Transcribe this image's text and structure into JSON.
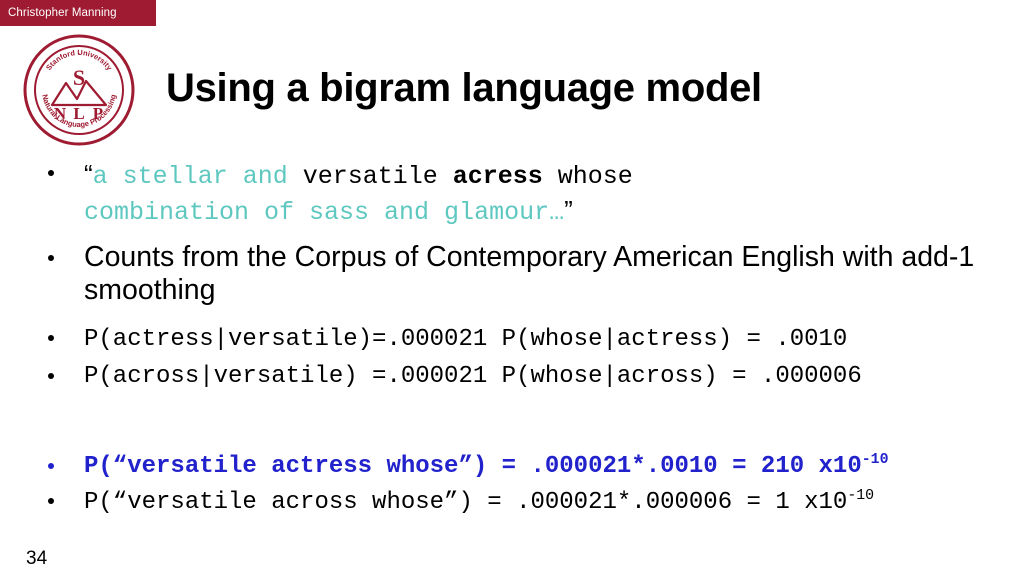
{
  "header": {
    "author_name": "Christopher Manning",
    "bar_color": "#9e1b32"
  },
  "logo": {
    "alt": "stanford-nlp-logo",
    "top_text": "Stanford University",
    "bottom_text": "Natural Language Processing",
    "letters": [
      "S",
      "N",
      "L",
      "P"
    ],
    "color": "#9e1b32"
  },
  "title": "Using a bigram language model",
  "slide_number": "34",
  "colors": {
    "teal": "#5ec8c0",
    "blue": "#2222cc",
    "black": "#000000"
  },
  "bullets": {
    "quote": {
      "open_quote": "“",
      "teal_part_1": "a stellar and ",
      "plain_part_1": "versatile ",
      "bold_part": "acress",
      "plain_part_2": " whose",
      "teal_part_2": "combination of sass and glamour…",
      "close_quote": "”"
    },
    "counts": "Counts from the Corpus of Contemporary American English with add-1 smoothing",
    "line_actress": "P(actress|versatile)=.000021 P(whose|actress) = .0010",
    "line_across": "P(across|versatile) =.000021 P(whose|across) = .000006",
    "result_blue": {
      "text_before": "P(“versatile actress whose”) = .000021*.0010 = 210 x10",
      "exponent": "-10"
    },
    "result_black": {
      "text_before": "P(“versatile across whose”)  = .000021*.000006 = 1 x10",
      "exponent": "-10"
    }
  }
}
